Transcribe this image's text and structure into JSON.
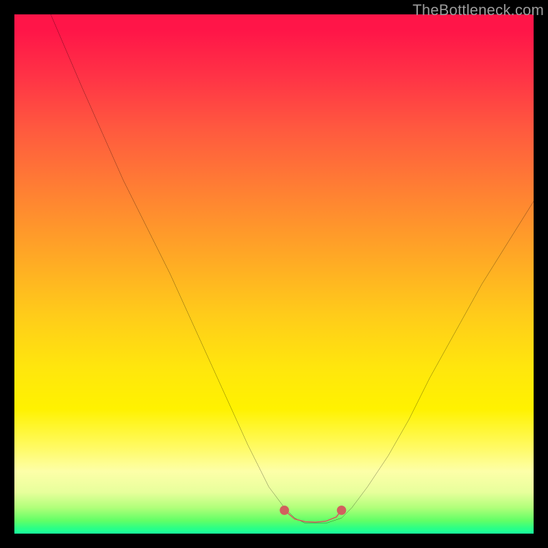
{
  "watermark": "TheBottleneck.com",
  "chart_data": {
    "type": "line",
    "title": "",
    "xlabel": "",
    "ylabel": "",
    "xlim": [
      0,
      100
    ],
    "ylim": [
      0,
      100
    ],
    "grid": false,
    "legend": false,
    "series": [
      {
        "name": "bottleneck-curve",
        "color": "#000000",
        "x": [
          7,
          10,
          13,
          17,
          21,
          25,
          30,
          35,
          40,
          45,
          49,
          52,
          54,
          56,
          58,
          60,
          63,
          65,
          68,
          72,
          76,
          80,
          85,
          90,
          95,
          100
        ],
        "y": [
          100,
          93,
          86,
          77,
          68,
          60,
          50,
          39,
          28,
          17,
          9,
          5,
          3,
          2,
          2,
          2,
          3,
          5,
          9,
          15,
          22,
          30,
          39,
          48,
          56,
          64
        ]
      },
      {
        "name": "optimal-band",
        "color": "#d1605e",
        "x": [
          52,
          54,
          56,
          58,
          60,
          62,
          63
        ],
        "y": [
          4.5,
          2.8,
          2.3,
          2.2,
          2.4,
          3.2,
          4.5
        ]
      }
    ],
    "background_gradient": {
      "top": "#ff1548",
      "mid": "#ffe60d",
      "bottom": "#18ff9f"
    }
  }
}
